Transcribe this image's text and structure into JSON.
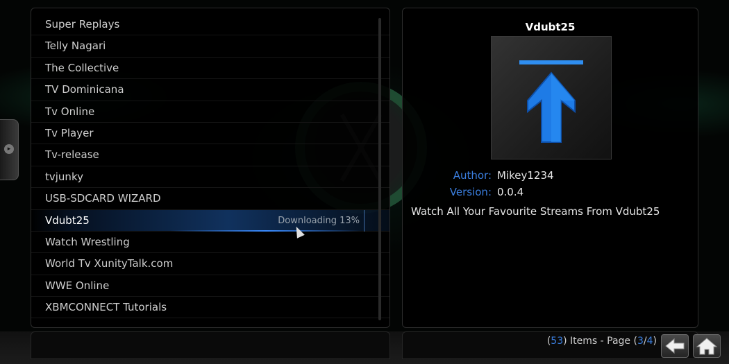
{
  "addon_list": {
    "items": [
      "Super Replays",
      "Telly Nagari",
      "The Collective",
      "TV Dominicana",
      "Tv Online",
      "Tv Player",
      "Tv-release",
      "tvjunky",
      "USB-SDCARD WIZARD",
      "Vdubt25",
      "Watch Wrestling",
      "World Tv XunityTalk.com",
      "WWE Online",
      "XBMCONNECT Tutorials"
    ],
    "selected_index": 9,
    "selected_status": "Downloading 13%",
    "download_progress_percent": 13
  },
  "info": {
    "title": "Vdubt25",
    "author_label": "Author:",
    "author_value": "Mikey1234",
    "version_label": "Version:",
    "version_value": "0.0.4",
    "description": "Watch All Your Favourite Streams From Vdubt25"
  },
  "footer": {
    "open_paren": "(",
    "item_count": "53",
    "items_text": ") Items - Page (",
    "page_current": "3",
    "page_sep": "/",
    "page_total": "4",
    "close_paren": ")"
  },
  "icons": {
    "back": "back-arrow-icon",
    "home": "home-icon",
    "thumb": "up-arrow-icon",
    "side": "chevron-right-icon"
  },
  "colors": {
    "accent": "#3b7fe0",
    "selection": "#1e5aaa",
    "thumb_arrow": "#1e7be6"
  }
}
